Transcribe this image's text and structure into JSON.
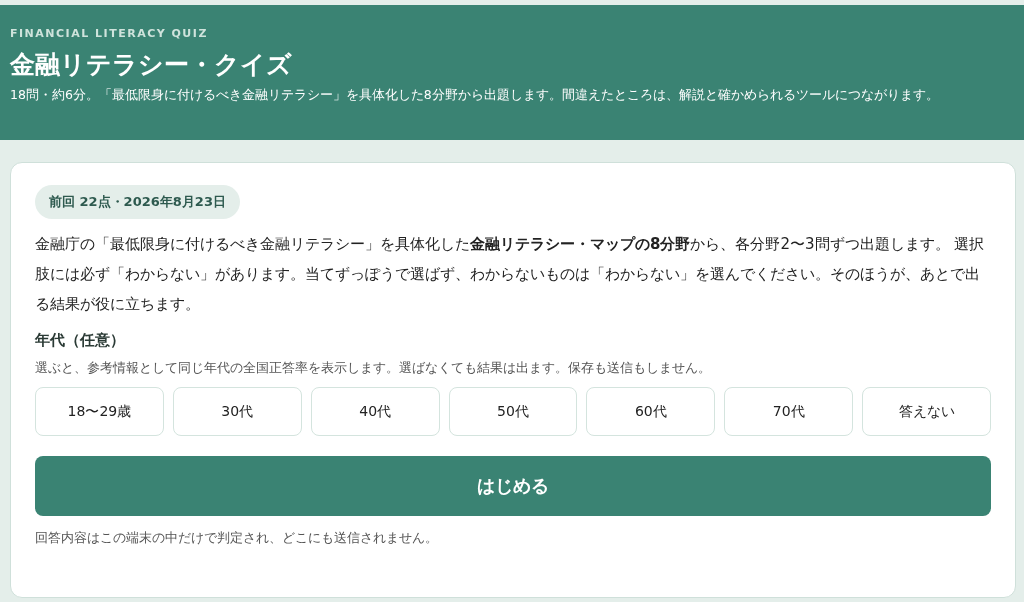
{
  "header": {
    "eyebrow": "FINANCIAL LITERACY QUIZ",
    "title": "金融リテラシー・クイズ",
    "subtitle": "18問・約6分。「最低限身に付けるべき金融リテラシー」を具体化した8分野から出題します。間違えたところは、解説と確かめられるツールにつながります。"
  },
  "card": {
    "last_result": "前回 22点・2026年8月23日",
    "intro": "金融庁の「最低限身に付けるべき金融リテラシー」を具体化した**金融リテラシー・マップの8分野**から、各分野2〜3問ずつ出題します。 選択肢には必ず「わからない」があります。当てずっぽうで選ばず、わからないものは「わからない」を選んでください。そのほうが、あとで出る結果が役に立ちます。",
    "age_label": "年代（任意）",
    "age_hint": "選ぶと、参考情報として同じ年代の全国正答率を表示します。選ばなくても結果は出ます。保存も送信もしません。",
    "age_options": [
      {
        "label": "18〜29歳",
        "selected": false
      },
      {
        "label": "30代",
        "selected": false
      },
      {
        "label": "40代",
        "selected": false
      },
      {
        "label": "50代",
        "selected": false
      },
      {
        "label": "60代",
        "selected": false
      },
      {
        "label": "70代",
        "selected": false
      },
      {
        "label": "答えない",
        "selected": false
      }
    ],
    "start_button": "はじめる",
    "footnote": "回答内容はこの端末の中だけで判定され、どこにも送信されません。"
  }
}
